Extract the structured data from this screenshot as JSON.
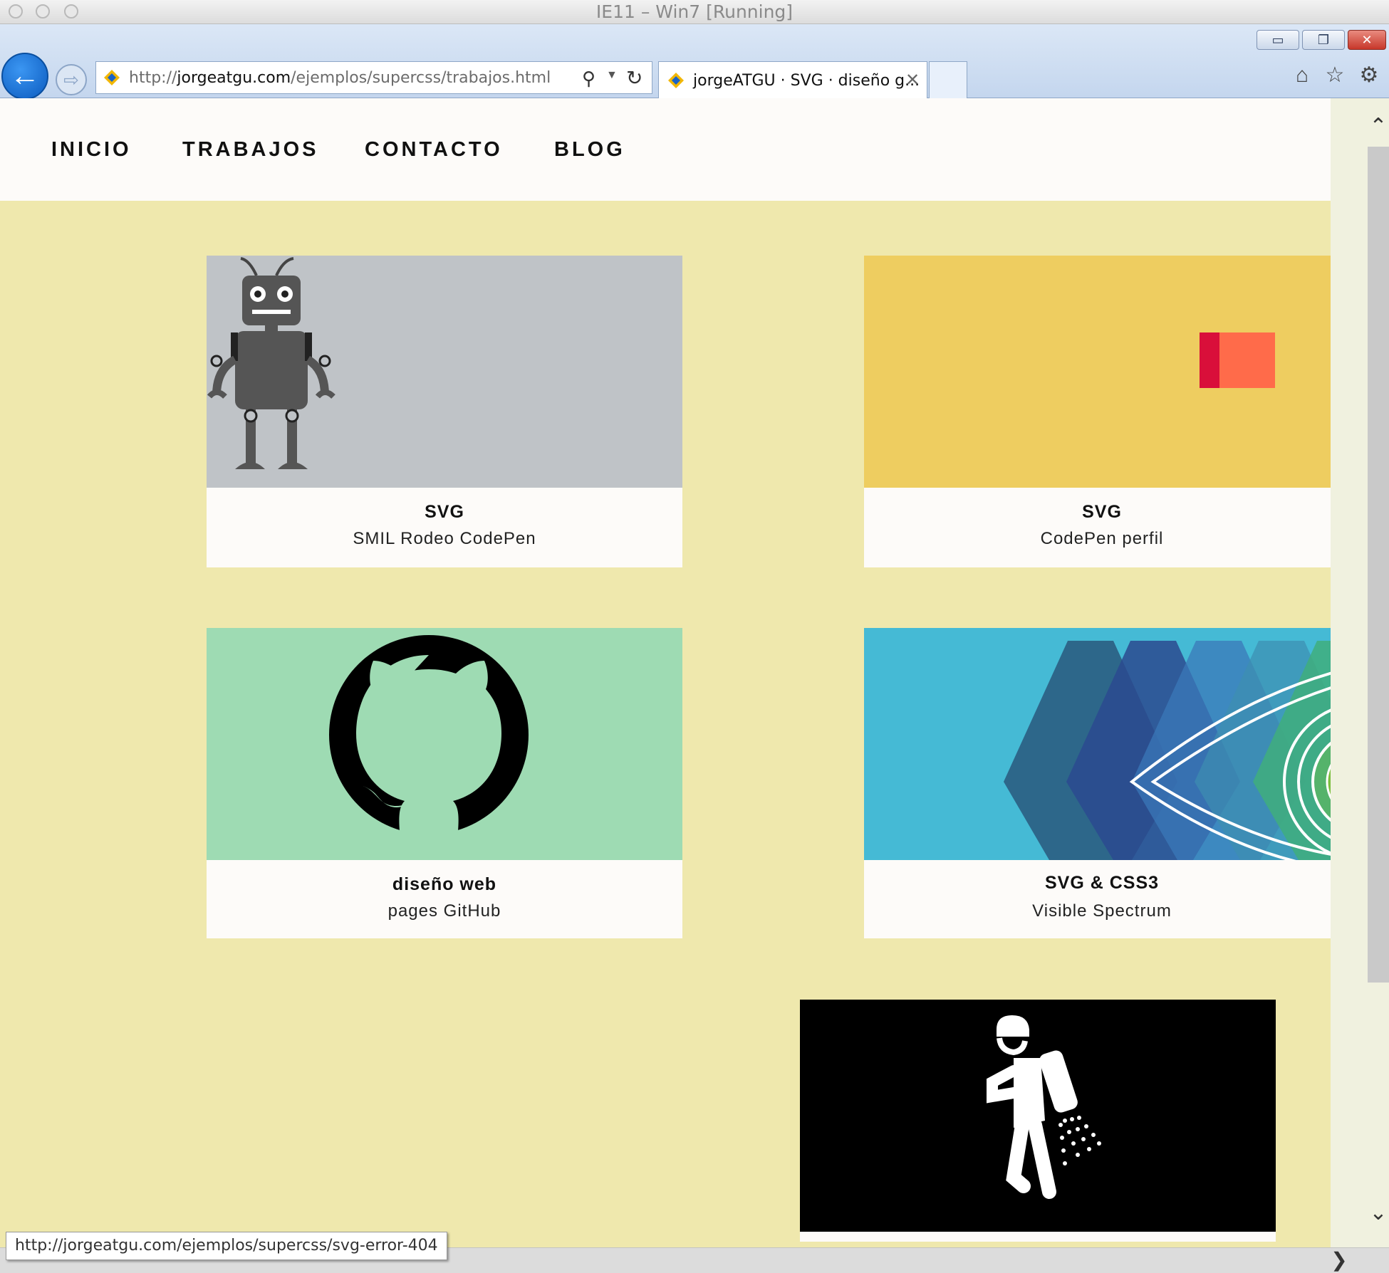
{
  "window": {
    "title": "IE11 – Win7 [Running]",
    "controls": {
      "minimize": "▭",
      "restore": "❐",
      "close": "✕"
    }
  },
  "browser": {
    "address": {
      "prefix": "http://",
      "domain": "jorgeatgu.com",
      "path": "/ejemplos/supercss/trabajos.html"
    },
    "tab_title": "jorgeATGU · SVG · diseño g...",
    "tab_close": "✕",
    "icons": {
      "back": "back-arrow-icon",
      "forward": "forward-arrow-icon",
      "search": "search-icon",
      "refresh": "refresh-icon",
      "home": "home-icon",
      "favorites": "star-icon",
      "settings": "gear-icon"
    }
  },
  "nav": {
    "items": [
      "INICIO",
      "TRABAJOS",
      "CONTACTO",
      "BLOG"
    ]
  },
  "cards": [
    {
      "title": "SVG",
      "subtitle": "SMIL Rodeo CodePen",
      "bg": "#bfc3c7"
    },
    {
      "title": "SVG",
      "subtitle": "CodePen perfil",
      "bg": "#eecd60"
    },
    {
      "title": "diseño web",
      "subtitle": "pages GitHub",
      "bg": "#9edbb3"
    },
    {
      "title": "SVG & CSS3",
      "subtitle": "Visible Spectrum",
      "bg": "#45bad5"
    },
    {
      "title": "",
      "subtitle": "",
      "bg": "#000000"
    }
  ],
  "status_bar": {
    "link_preview": "http://jorgeatgu.com/ejemplos/supercss/svg-error-404"
  },
  "colors": {
    "page_bg": "#efe8ad",
    "nav_bg": "#fdfbf9",
    "card_bg": "#fdfbf9"
  }
}
